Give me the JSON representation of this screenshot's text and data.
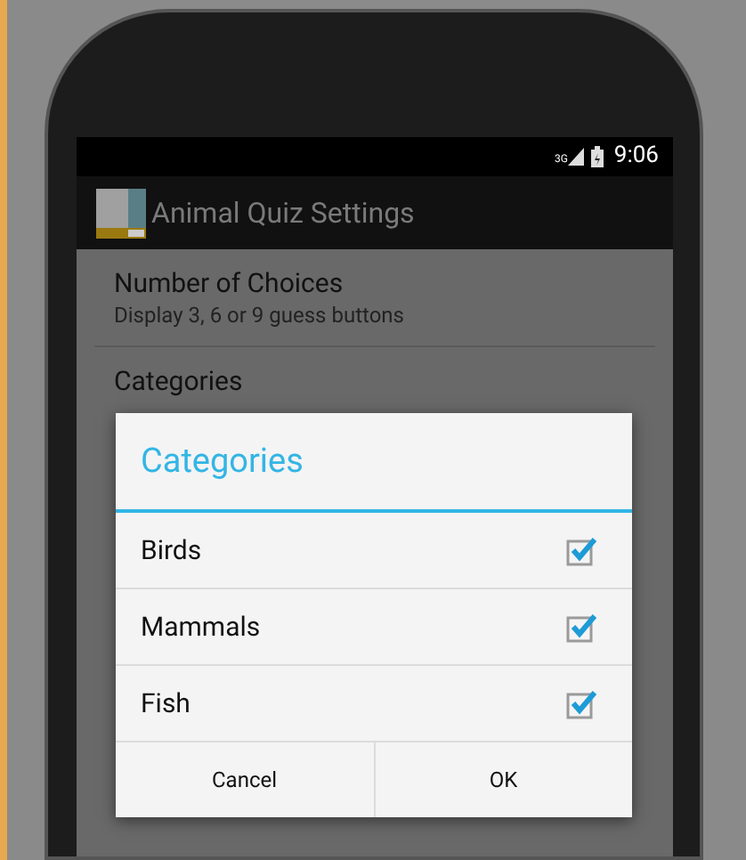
{
  "status_bar": {
    "network": "3G",
    "time": "9:06"
  },
  "action_bar": {
    "title": "Animal Quiz Settings"
  },
  "preferences": [
    {
      "title": "Number of Choices",
      "summary": "Display 3, 6 or 9 guess buttons"
    },
    {
      "title": "Categories"
    }
  ],
  "dialog": {
    "title": "Categories",
    "items": [
      {
        "label": "Birds",
        "checked": true
      },
      {
        "label": "Mammals",
        "checked": true
      },
      {
        "label": "Fish",
        "checked": true
      }
    ],
    "buttons": [
      "Cancel",
      "OK"
    ]
  }
}
